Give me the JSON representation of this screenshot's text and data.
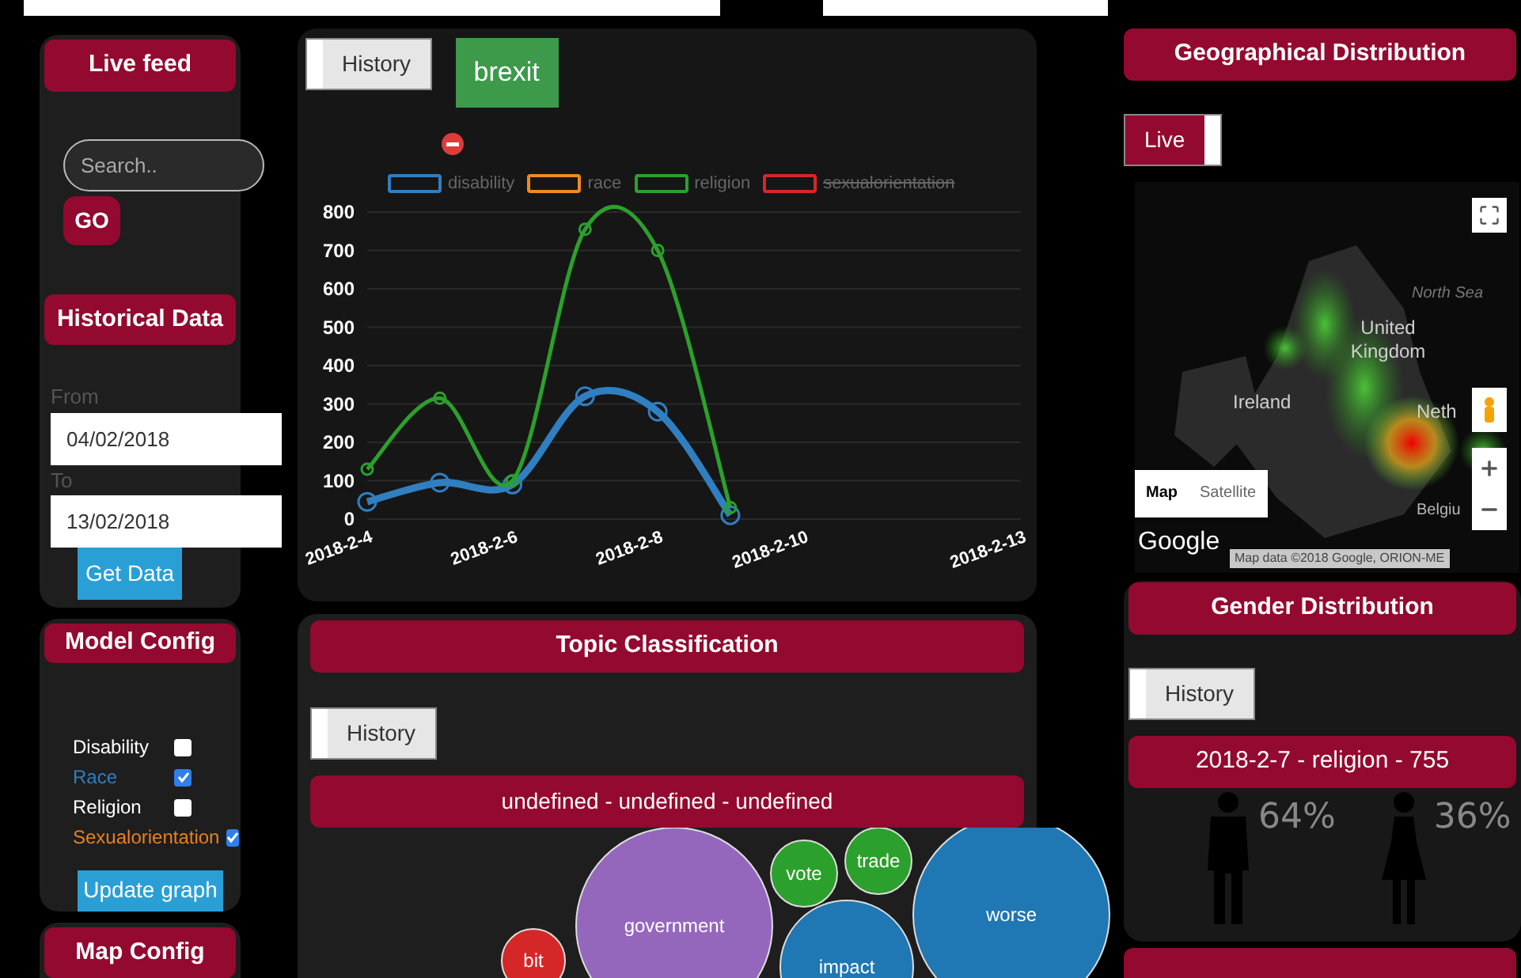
{
  "sidebar": {
    "live_feed": {
      "title": "Live feed",
      "search": {
        "placeholder": "Search.."
      },
      "go_button": "GO"
    },
    "historical_data": {
      "title": "Historical Data",
      "from_label": "From",
      "from_value": "04/02/2018",
      "to_label": "To",
      "to_value": "13/02/2018",
      "button": "Get Data"
    },
    "model_config": {
      "title": "Model Config",
      "options": [
        {
          "label": "Disability",
          "checked": false,
          "color": "#ffffff"
        },
        {
          "label": "Race",
          "checked": true,
          "color": "#2f7fc1"
        },
        {
          "label": "Religion",
          "checked": false,
          "color": "#ffffff"
        },
        {
          "label": "Sexualorientation",
          "checked": true,
          "color": "#e8801e"
        }
      ],
      "button": "Update graph"
    },
    "map_config": {
      "title": "Map Config"
    }
  },
  "trend_panel": {
    "history_toggle": {
      "label": "History",
      "on": false
    },
    "keyword": "brexit",
    "legend_struck": [
      false,
      false,
      false,
      true
    ],
    "chart_data": {
      "type": "line",
      "categories": [
        "2018-2-4",
        null,
        "2018-2-6",
        null,
        "2018-2-8",
        null,
        "2018-2-10",
        null,
        null,
        "2018-2-13"
      ],
      "grid": true,
      "series": [
        {
          "name": "disability",
          "color": "#2f7fc1",
          "marker": "circle",
          "values": [
            45,
            95,
            90,
            320,
            280,
            10,
            null,
            null,
            null,
            null
          ]
        },
        {
          "name": "race",
          "color": "#f28a1e",
          "values": [
            null,
            null,
            null,
            null,
            null,
            null,
            null,
            null,
            null,
            null
          ]
        },
        {
          "name": "religion",
          "color": "#2ca02c",
          "marker": "circle",
          "values": [
            130,
            315,
            100,
            755,
            700,
            30,
            null,
            null,
            null,
            null
          ]
        },
        {
          "name": "sexualorientation",
          "color": "#d62728",
          "values": [
            null,
            null,
            null,
            null,
            null,
            null,
            null,
            null,
            null,
            null
          ]
        }
      ],
      "ylim": [
        0,
        800
      ],
      "yticks": [
        0,
        100,
        200,
        300,
        400,
        500,
        600,
        700,
        800
      ]
    }
  },
  "topic_panel": {
    "title": "Topic Classification",
    "history_toggle": {
      "label": "History",
      "on": false
    },
    "selection": "undefined - undefined - undefined",
    "topics": [
      {
        "label": "bit",
        "color": "#d62728"
      },
      {
        "label": "government",
        "color": "#9467bd"
      },
      {
        "label": "vote",
        "color": "#2ca02c"
      },
      {
        "label": "trade",
        "color": "#2ca02c"
      },
      {
        "label": "impact",
        "color": "#1f77b4"
      },
      {
        "label": "worse",
        "color": "#1f77b4"
      }
    ]
  },
  "geo_panel": {
    "title": "Geographical Distribution",
    "live_toggle": {
      "label": "Live",
      "on": true
    },
    "map": {
      "labels": [
        {
          "text": "North Sea",
          "kind": "sea"
        },
        {
          "text": "United Kingdom",
          "kind": "country"
        },
        {
          "text": "Ireland",
          "kind": "country"
        },
        {
          "text": "Neth",
          "kind": "country"
        },
        {
          "text": "Belgiu",
          "kind": "small"
        }
      ],
      "map_types": [
        {
          "label": "Map",
          "selected": true
        },
        {
          "label": "Satellite",
          "selected": false
        }
      ],
      "logo": "Google",
      "attribution": "Map data ©2018 Google, ORION-ME"
    }
  },
  "gender_panel": {
    "title": "Gender Distribution",
    "history_toggle": {
      "label": "History",
      "on": false
    },
    "selection": "2018-2-7 - religion - 755",
    "male_share": "64%",
    "female_share": "36%"
  }
}
